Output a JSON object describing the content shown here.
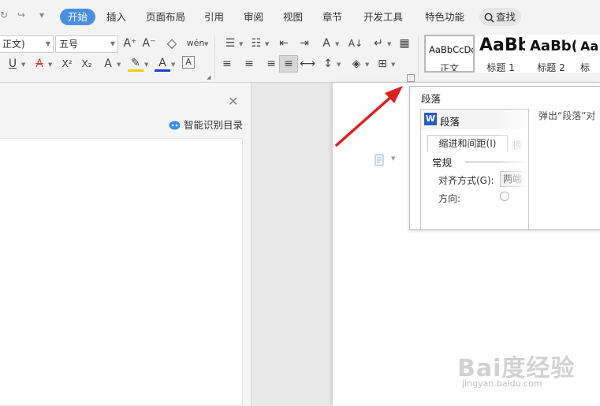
{
  "ribbon": {
    "quick_access": [
      "↻",
      "↪",
      "▾"
    ],
    "tabs": [
      "开始",
      "插入",
      "页面布局",
      "引用",
      "审阅",
      "视图",
      "章节",
      "开发工具",
      "特色功能"
    ],
    "active_tab": "开始",
    "search_label": "查找"
  },
  "font": {
    "name_value": "正文)",
    "size_value": "五号",
    "grow_label": "A⁺",
    "shrink_label": "A⁻",
    "clear_label": "◇",
    "pinyin_label": "wén",
    "underline_label": "U",
    "strike_label": "A",
    "superscript_label": "X²",
    "subscript_label": "X₂",
    "effect_label": "A",
    "highlight_label": "✎",
    "color_label": "A",
    "border_label": "A"
  },
  "paragraph": {
    "bullets": "☰",
    "numbering": "☷",
    "indent_dec": "⇤",
    "indent_inc": "⇥",
    "asian_layout": "A",
    "sort": "A↓",
    "show_marks": "↵",
    "table_grid": "▦",
    "align_left": "≡",
    "align_center": "≡",
    "align_right": "≡",
    "justify": "≡",
    "distributed": "⟷",
    "line_spacing": "↕",
    "shading": "◈",
    "borders": "⊞"
  },
  "styles": [
    {
      "preview": "AaBbCcDd",
      "name": "正文"
    },
    {
      "preview": "AaBb",
      "name": "标题 1"
    },
    {
      "preview": "AaBb(",
      "name": "标题 2"
    },
    {
      "preview": "AaB",
      "name": "标"
    }
  ],
  "nav_pane": {
    "close_label": "✕",
    "smart_toc_label": "智能识别目录"
  },
  "tooltip": {
    "title": "段落",
    "description": "弹出“段落”对",
    "dialog": {
      "title": "段落",
      "logo": "W",
      "active_tab": "缩进和间距(I)",
      "other_tab": "换",
      "section": "常规",
      "align_label": "对齐方式(G):",
      "align_value": "两端",
      "direction_label": "方向:"
    }
  },
  "watermark": {
    "brand": "Bai度经验",
    "url": "jingyan.baidu.com"
  },
  "colors": {
    "active_tab": "#4a90e2",
    "highlight": "#f3d200",
    "font_color": "#1a3fd8",
    "strike_color": "#d64040",
    "arrow": "#e02020"
  }
}
